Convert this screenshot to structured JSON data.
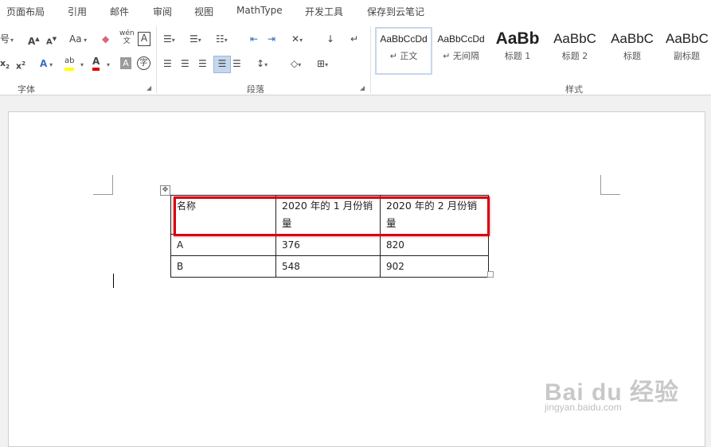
{
  "tabs": [
    "页面布局",
    "引用",
    "邮件",
    "审阅",
    "视图",
    "MathType",
    "开发工具",
    "保存到云笔记"
  ],
  "ribbon": {
    "groups": {
      "font": "字体",
      "paragraph": "段落",
      "styles": "样式"
    },
    "font_size_fragment": "号",
    "change_case": "Aa",
    "styles": [
      {
        "preview": "AaBbCcDd",
        "name": "↵ 正文"
      },
      {
        "preview": "AaBbCcDd",
        "name": "↵ 无间隔"
      },
      {
        "preview": "AaBb",
        "name": "标题 1"
      },
      {
        "preview": "AaBbC",
        "name": "标题 2"
      },
      {
        "preview": "AaBbC",
        "name": "标题"
      },
      {
        "preview": "AaBbC",
        "name": "副标题"
      }
    ]
  },
  "table": {
    "header": [
      "名称",
      "2020 年的 1 月份销量",
      "2020 年的 2 月份销量"
    ],
    "rows": [
      [
        "A",
        "376",
        "820"
      ],
      [
        "B",
        "548",
        "902"
      ]
    ]
  },
  "watermark": {
    "logo": "Bai du 经验",
    "url": "jingyan.baidu.com"
  }
}
